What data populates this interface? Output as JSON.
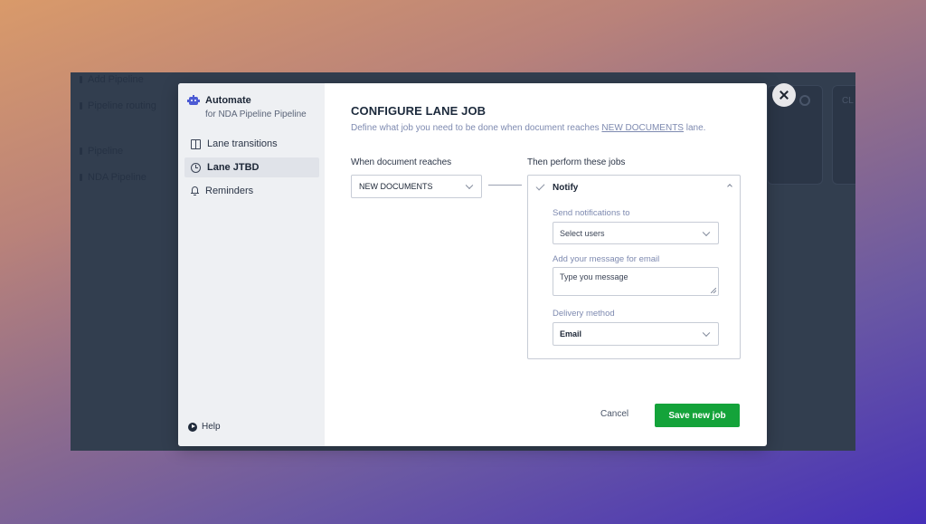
{
  "background_app": {
    "nav_items": [
      "Add Pipeline",
      "Pipeline routing",
      "Pipeline",
      "NDA Pipeline"
    ],
    "card_text": "CL"
  },
  "sidebar": {
    "title": "Automate",
    "subtitle": "for NDA Pipeline Pipeline",
    "items": [
      {
        "label": "Lane transitions",
        "icon": "split-view-icon"
      },
      {
        "label": "Lane JTBD",
        "icon": "alarm-clock-icon"
      },
      {
        "label": "Reminders",
        "icon": "bell-icon"
      }
    ],
    "help_label": "Help"
  },
  "main": {
    "title": "CONFIGURE LANE JOB",
    "description_prefix": "Define what job you need to be done when document reaches",
    "description_link": "NEW DOCUMENTS",
    "description_suffix": "lane.",
    "when_label": "When document reaches",
    "when_value": "NEW DOCUMENTS",
    "then_label": "Then perform these jobs",
    "job": {
      "title": "Notify",
      "notify_label": "Send notifications to",
      "notify_placeholder": "Select users",
      "message_label": "Add your message for email",
      "message_placeholder": "Type you message",
      "delivery_label": "Delivery method",
      "delivery_value": "Email"
    },
    "cancel_label": "Cancel",
    "save_label": "Save new job"
  },
  "colors": {
    "accent": "#4c5bd4",
    "save_button": "#14a33a",
    "muted_text": "#7e8ab0"
  }
}
